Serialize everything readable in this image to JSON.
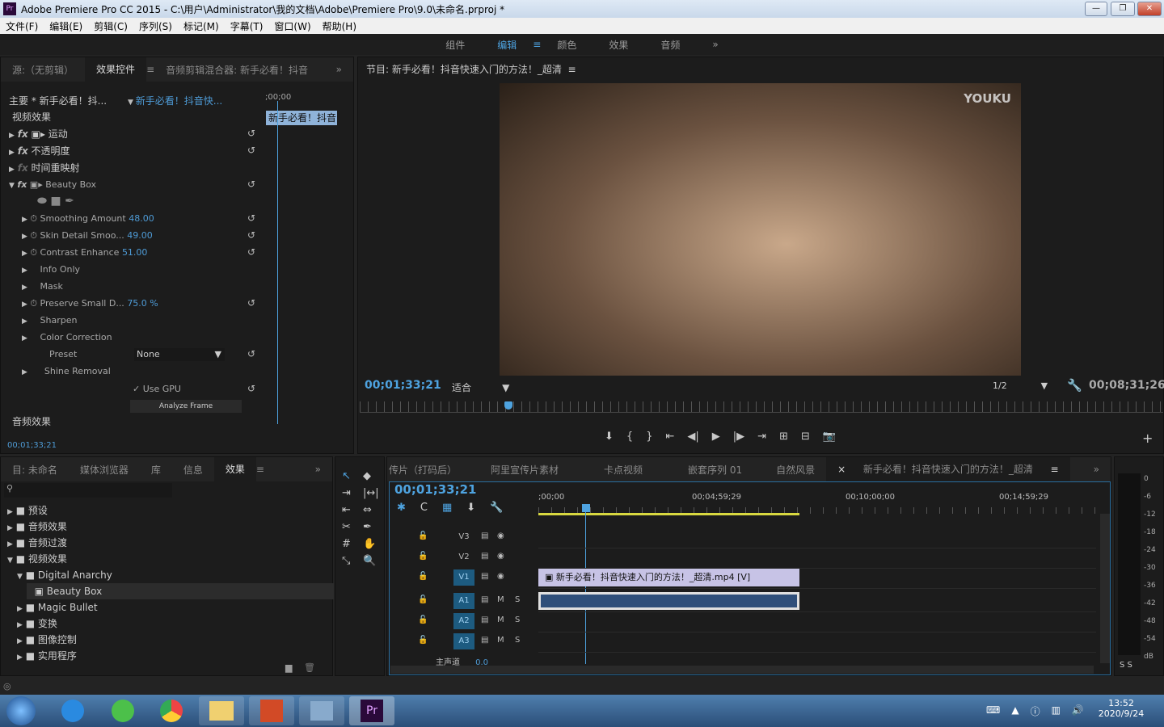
{
  "window": {
    "title": "Adobe Premiere Pro CC 2015 - C:\\用户\\Administrator\\我的文档\\Adobe\\Premiere Pro\\9.0\\未命名.prproj *",
    "app_icon": "Pr"
  },
  "menu": [
    "文件(F)",
    "编辑(E)",
    "剪辑(C)",
    "序列(S)",
    "标记(M)",
    "字幕(T)",
    "窗口(W)",
    "帮助(H)"
  ],
  "workspaces": [
    "组件",
    "编辑",
    "颜色",
    "效果",
    "音频"
  ],
  "workspace_active": "编辑",
  "effect_controls": {
    "tabs": [
      "源:（无剪辑）",
      "效果控件",
      "音频剪辑混合器: 新手必看！抖音"
    ],
    "master": "主要 * 新手必看！抖...",
    "clip": "新手必看！抖音快...",
    "time_start": ";00;00",
    "clip_bar": "新手必看！抖音",
    "video_effects": "视频效果",
    "audio_effects": "音频效果",
    "time": "00;01;33;21",
    "effects": [
      "运动",
      "不透明度",
      "时间重映射",
      "Beauty Box"
    ],
    "params": [
      {
        "name": "Smoothing Amount",
        "value": "48.00"
      },
      {
        "name": "Skin Detail Smoo...",
        "value": "49.00"
      },
      {
        "name": "Contrast Enhance",
        "value": "51.00"
      },
      {
        "name": "Info Only",
        "value": ""
      },
      {
        "name": "Mask",
        "value": ""
      },
      {
        "name": "Preserve Small D...",
        "value": "75.0 %"
      },
      {
        "name": "Sharpen",
        "value": ""
      },
      {
        "name": "Color Correction",
        "value": ""
      }
    ],
    "preset_label": "Preset",
    "preset_value": "None",
    "shine": "Shine Removal",
    "use_gpu": "Use GPU",
    "analyze": "Analyze Frame"
  },
  "program": {
    "title": "节目: 新手必看！抖音快速入门的方法！_超清",
    "watermark": "YOUKU",
    "time": "00;01;33;21",
    "fit": "适合",
    "res": "1/2",
    "duration": "00;08;31;26",
    "playhead_fraction": 0.18
  },
  "project": {
    "tabs": [
      "目: 未命名",
      "媒体浏览器",
      "库",
      "信息",
      "效果"
    ],
    "tree": [
      {
        "label": "预设",
        "lvl": 0
      },
      {
        "label": "音频效果",
        "lvl": 0
      },
      {
        "label": "音频过渡",
        "lvl": 0
      },
      {
        "label": "视频效果",
        "lvl": 0,
        "open": true
      },
      {
        "label": "Digital Anarchy",
        "lvl": 1,
        "open": true
      },
      {
        "label": "Beauty Box",
        "lvl": 2,
        "selected": true
      },
      {
        "label": "Magic Bullet",
        "lvl": 1
      },
      {
        "label": "变换",
        "lvl": 1
      },
      {
        "label": "图像控制",
        "lvl": 1
      },
      {
        "label": "实用程序",
        "lvl": 1
      }
    ]
  },
  "timeline": {
    "tabs": [
      "传片（打码后）",
      "阿里宣传片素材",
      "卡点视频",
      "嵌套序列 01",
      "自然风景",
      "新手必看！抖音快速入门的方法！_超清"
    ],
    "time": "00;01;33;21",
    "ruler": [
      ";00;00",
      "00;04;59;29",
      "00;10;00;00",
      "00;14;59;29"
    ],
    "tracks": [
      "V3",
      "V2",
      "V1",
      "A1",
      "A2",
      "A3"
    ],
    "master": "主声道",
    "master_val": "0.0",
    "video_clip": "新手必看！抖音快速入门的方法！_超清.mp4 [V]"
  },
  "meter": {
    "ticks": [
      "0",
      "-6",
      "-12",
      "-18",
      "-24",
      "-30",
      "-36",
      "-42",
      "-48",
      "-54",
      "dB"
    ],
    "solo": "S S"
  },
  "taskbar": {
    "time": "13:52",
    "date": "2020/9/24"
  }
}
